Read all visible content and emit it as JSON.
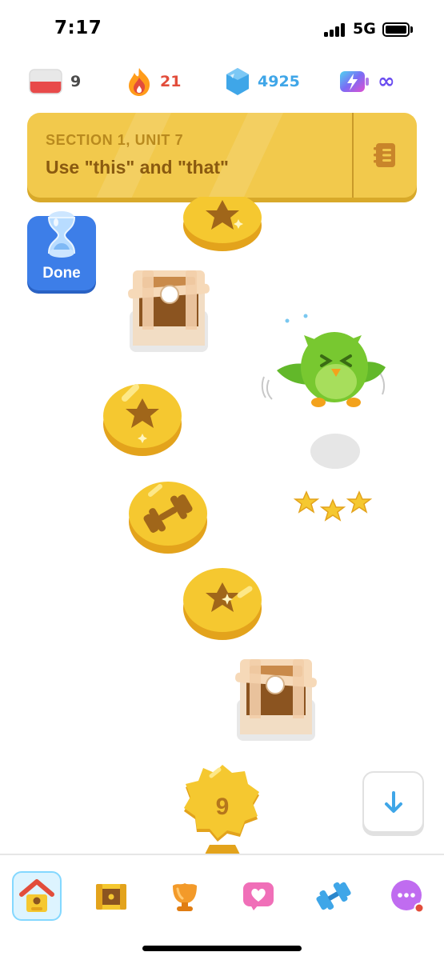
{
  "status_bar": {
    "time": "7:17",
    "network": "5G"
  },
  "stats": {
    "language_flag_icon": "flag-icon",
    "courses_count": "9",
    "streak_icon": "flame-icon",
    "streak_count": "21",
    "gems_icon": "gem-icon",
    "gems_count": "4925",
    "energy_icon": "energy-battery-icon",
    "energy_value": "∞",
    "colors": {
      "courses": "#4b4b4b",
      "streak": "#e24d3b",
      "gems": "#3fa6e8",
      "energy": "#6a4cf0"
    }
  },
  "unit": {
    "section": "SECTION 1, UNIT 7",
    "title": "Use \"this\" and \"that\"",
    "guidebook_icon": "notebook-icon",
    "color": "#f2c94c"
  },
  "done_badge": {
    "label": "Done",
    "icon": "hourglass-icon"
  },
  "path": {
    "nodes": [
      {
        "type": "lesson",
        "icon": "star-icon",
        "state": "completed"
      },
      {
        "type": "chest",
        "icon": "chest-icon",
        "state": "opened"
      },
      {
        "type": "lesson",
        "icon": "star-icon",
        "state": "completed"
      },
      {
        "type": "practice",
        "icon": "dumbbell-icon",
        "state": "completed"
      },
      {
        "type": "lesson",
        "icon": "star-icon",
        "state": "completed"
      },
      {
        "type": "chest",
        "icon": "chest-icon",
        "state": "opened"
      },
      {
        "type": "unit-review",
        "icon": "trophy-badge-icon",
        "label": "9",
        "state": "completed"
      }
    ],
    "mascot": "owl-mascot-icon",
    "stars_earned": 3
  },
  "scroll_down_icon": "arrow-down-icon",
  "bottom_nav": {
    "items": [
      {
        "name": "learn",
        "icon": "home-icon",
        "active": true
      },
      {
        "name": "quests",
        "icon": "chest-icon",
        "active": false
      },
      {
        "name": "leagues",
        "icon": "trophy-icon",
        "active": false
      },
      {
        "name": "friends",
        "icon": "heart-icon",
        "active": false
      },
      {
        "name": "practice",
        "icon": "dumbbell-icon",
        "active": false
      },
      {
        "name": "more",
        "icon": "more-icon",
        "active": false,
        "badge": true
      }
    ]
  }
}
